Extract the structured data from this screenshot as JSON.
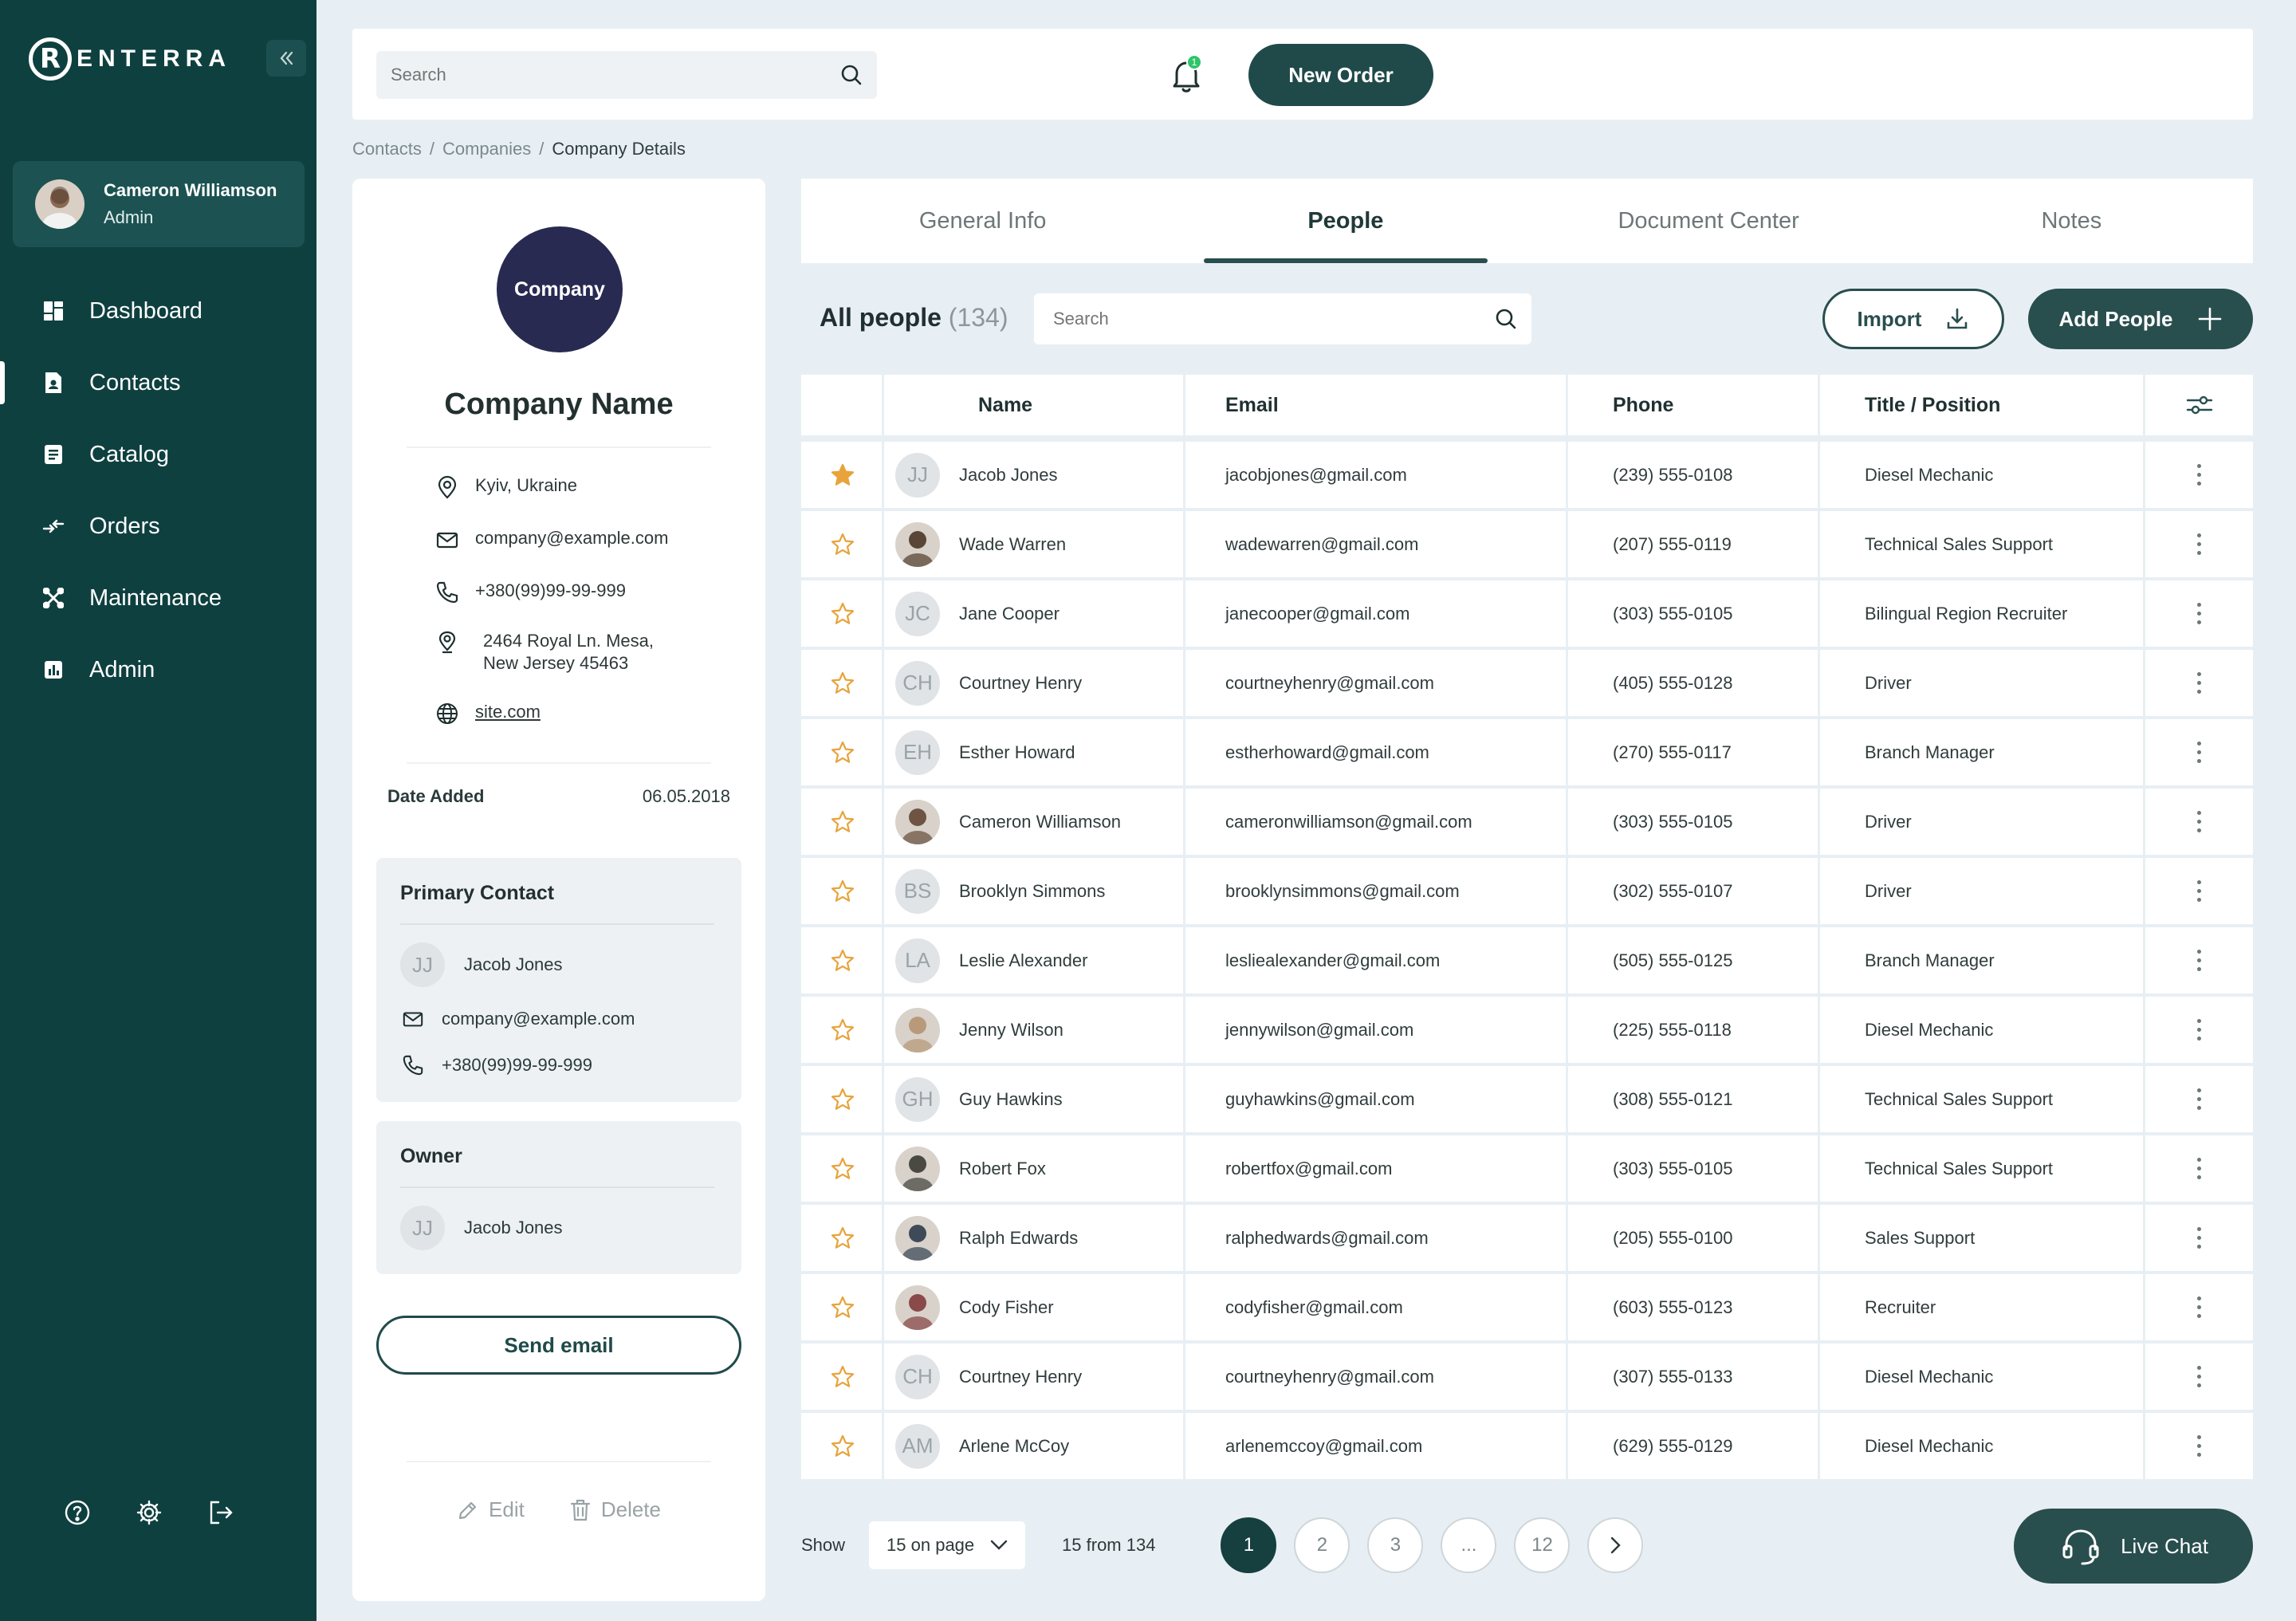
{
  "brand": {
    "logo_letter": "R",
    "logo_text": "ENTERRA"
  },
  "user": {
    "name": "Cameron Williamson",
    "role": "Admin"
  },
  "nav": [
    {
      "label": "Dashboard",
      "icon": "dashboard-icon"
    },
    {
      "label": "Contacts",
      "icon": "contacts-icon",
      "active": true
    },
    {
      "label": "Catalog",
      "icon": "catalog-icon"
    },
    {
      "label": "Orders",
      "icon": "orders-icon"
    },
    {
      "label": "Maintenance",
      "icon": "maintenance-icon"
    },
    {
      "label": "Admin",
      "icon": "admin-chart-icon"
    }
  ],
  "topbar": {
    "search_placeholder": "Search",
    "notification_count": "1",
    "new_order_label": "New Order"
  },
  "breadcrumb": {
    "contacts": "Contacts",
    "companies": "Companies",
    "current": "Company Details",
    "separator": "/"
  },
  "company": {
    "logo_text": "Company",
    "name": "Company Name",
    "location": "Kyiv, Ukraine",
    "email": "company@example.com",
    "phone": "+380(99)99-99-999",
    "address_line1": "2464 Royal Ln. Mesa,",
    "address_line2": "New Jersey 45463",
    "website": "site.com",
    "date_added_label": "Date Added",
    "date_added": "06.05.2018"
  },
  "primary_contact": {
    "title": "Primary Contact",
    "initials": "JJ",
    "name": "Jacob Jones",
    "email": "company@example.com",
    "phone": "+380(99)99-99-999"
  },
  "owner": {
    "title": "Owner",
    "initials": "JJ",
    "name": "Jacob Jones"
  },
  "card_actions": {
    "send_email": "Send email",
    "edit": "Edit",
    "delete": "Delete"
  },
  "tabs": [
    {
      "label": "General Info"
    },
    {
      "label": "People",
      "active": true
    },
    {
      "label": "Document Center"
    },
    {
      "label": "Notes"
    }
  ],
  "people": {
    "title": "All people",
    "count": "(134)",
    "search_placeholder": "Search",
    "import_label": "Import",
    "add_label": "Add People",
    "columns": {
      "name": "Name",
      "email": "Email",
      "phone": "Phone",
      "title": "Title / Position"
    },
    "colors": {
      "star": "#e8a33a",
      "accent": "#294e4e"
    },
    "rows": [
      {
        "starred": true,
        "initials": "JJ",
        "photo": false,
        "name": "Jacob Jones",
        "email": "jacobjones@gmail.com",
        "phone": "(239) 555-0108",
        "title": "Diesel Mechanic"
      },
      {
        "starred": false,
        "initials": "",
        "photo": true,
        "photo_color": "#5a4636",
        "name": "Wade Warren",
        "email": "wadewarren@gmail.com",
        "phone": "(207) 555-0119",
        "title": "Technical Sales Support"
      },
      {
        "starred": false,
        "initials": "JC",
        "photo": false,
        "name": "Jane Cooper",
        "email": "janecooper@gmail.com",
        "phone": "(303) 555-0105",
        "title": "Bilingual Region Recruiter"
      },
      {
        "starred": false,
        "initials": "CH",
        "photo": false,
        "name": "Courtney Henry",
        "email": "courtneyhenry@gmail.com",
        "phone": "(405) 555-0128",
        "title": "Driver"
      },
      {
        "starred": false,
        "initials": "EH",
        "photo": false,
        "name": "Esther Howard",
        "email": "estherhoward@gmail.com",
        "phone": "(270) 555-0117",
        "title": "Branch Manager"
      },
      {
        "starred": false,
        "initials": "",
        "photo": true,
        "photo_color": "#6e5442",
        "name": "Cameron Williamson",
        "email": "cameronwilliamson@gmail.com",
        "phone": "(303) 555-0105",
        "title": "Driver"
      },
      {
        "starred": false,
        "initials": "BS",
        "photo": false,
        "name": "Brooklyn Simmons",
        "email": "brooklynsimmons@gmail.com",
        "phone": "(302) 555-0107",
        "title": "Driver"
      },
      {
        "starred": false,
        "initials": "LA",
        "photo": false,
        "name": "Leslie Alexander",
        "email": "lesliealexander@gmail.com",
        "phone": "(505) 555-0125",
        "title": "Branch Manager"
      },
      {
        "starred": false,
        "initials": "",
        "photo": true,
        "photo_color": "#b89a7a",
        "name": "Jenny Wilson",
        "email": "jennywilson@gmail.com",
        "phone": "(225) 555-0118",
        "title": "Diesel Mechanic"
      },
      {
        "starred": false,
        "initials": "GH",
        "photo": false,
        "name": "Guy Hawkins",
        "email": "guyhawkins@gmail.com",
        "phone": "(308) 555-0121",
        "title": "Technical Sales Support"
      },
      {
        "starred": false,
        "initials": "",
        "photo": true,
        "photo_color": "#4a4a42",
        "name": "Robert Fox",
        "email": "robertfox@gmail.com",
        "phone": "(303) 555-0105",
        "title": "Technical Sales Support"
      },
      {
        "starred": false,
        "initials": "",
        "photo": true,
        "photo_color": "#3e4a58",
        "name": "Ralph Edwards",
        "email": "ralphedwards@gmail.com",
        "phone": "(205) 555-0100",
        "title": "Sales Support"
      },
      {
        "starred": false,
        "initials": "",
        "photo": true,
        "photo_color": "#8a4a4a",
        "name": "Cody Fisher",
        "email": "codyfisher@gmail.com",
        "phone": "(603) 555-0123",
        "title": "Recruiter"
      },
      {
        "starred": false,
        "initials": "CH",
        "photo": false,
        "name": "Courtney Henry",
        "email": "courtneyhenry@gmail.com",
        "phone": "(307) 555-0133",
        "title": "Diesel Mechanic"
      },
      {
        "starred": false,
        "initials": "AM",
        "photo": false,
        "name": "Arlene McCoy",
        "email": "arlenemccoy@gmail.com",
        "phone": "(629) 555-0129",
        "title": "Diesel Mechanic"
      }
    ]
  },
  "pagination": {
    "show_label": "Show",
    "per_page": "15 on page",
    "summary": "15 from 134",
    "pages": [
      "1",
      "2",
      "3",
      "...",
      "12"
    ],
    "current": "1"
  },
  "live_chat": {
    "label": "Live Chat"
  }
}
